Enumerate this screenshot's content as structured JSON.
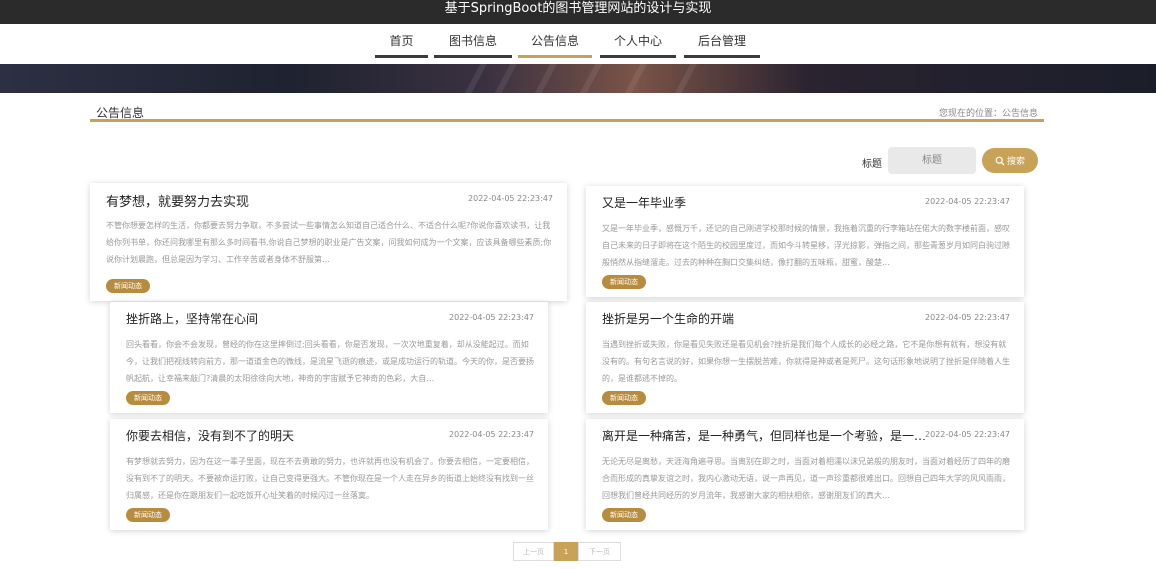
{
  "site_title": "基于SpringBoot的图书管理网站的设计与实现",
  "nav": [
    "首页",
    "图书信息",
    "公告信息",
    "个人中心",
    "后台管理"
  ],
  "section_title": "公告信息",
  "location": "您现在的位置：公告信息",
  "search": {
    "label": "标题",
    "placeholder": "标题",
    "button": "搜索"
  },
  "cards": [
    {
      "title": "有梦想，就要努力去实现",
      "date": "2022-04-05 22:23:47",
      "body": "不管你想要怎样的生活，你都要去努力争取，不多尝试一些事情怎么知道自己适合什么、不适合什么呢?你说你喜欢读书，让我给你列书单，你还问我哪里有那么多时间看书,你说自己梦想的职业是广告文案，问我如何成为一个文案，应该具备哪些素质;你说你计划晨跑，但总是因为学习、工作辛苦或者身体不舒服第…",
      "tag": "新闻动态"
    },
    {
      "title": "又是一年毕业季",
      "date": "2022-04-05 22:23:47",
      "body": "又是一年毕业季，感慨万千，还记的自己刚进学校那时候的情景，我拖着沉重的行李箱站在偌大的数字楼前面，感叹自己未来的日子即将在这个陌生的校园里度过，而如今斗转星移，浮光掠影，弹指之间，那些青葱岁月如同白驹过隙般悄然从指缝溜走。过去的种种在胸口交集纠结，像打翻的五味瓶，甜蜜，酸楚…",
      "tag": "新闻动态"
    },
    {
      "title": "挫折路上，坚持常在心间",
      "date": "2022-04-05 22:23:47",
      "body": "回头看看，你会不会发现，曾经的你在这里摔倒过;回头看看，你是否发现，一次次地重复着，却从没能起过。而如今，让我们把视线转向前方，那一道道金色的微线，是流星飞逝的痕迹，或是成功运行的轨道。今天的你，是否要扬帆起航，让幸福来敲门?清晨的太阳徐徐向大地，神奇的宇宙赋予它神奇的色彩，大自…",
      "tag": "新闻动态"
    },
    {
      "title": "挫折是另一个生命的开端",
      "date": "2022-04-05 22:23:47",
      "body": "当遇到挫折或失败，你是看见失败还是看见机会?挫折是我们每个人成长的必经之路，它不是你想有就有，想没有就没有的。有句名言说的好，如果你想一生摆脱苦难，你就得是神或者是死尸。这句话形象地说明了挫折是伴随着人生的，是谁都逃不掉的。",
      "tag": "新闻动态"
    },
    {
      "title": "你要去相信，没有到不了的明天",
      "date": "2022-04-05 22:23:47",
      "body": "有梦想就去努力，因为在这一辈子里面，现在不去勇敢的努力，也许就再也没有机会了。你要去相信，一定要相信，没有到不了的明天。不要被命运打败，让自己变得更强大。不管你现在是一个人走在异乡的街道上始终没有找到一丝归属感，还是你在跟朋友们一起吃饭开心址笑着的时候闪过一丝落寞。",
      "tag": "新闻动态"
    },
    {
      "title": "离开是一种痛苦，是一种勇气，但同样也是一个考验，是一个新的…",
      "date": "2022-04-05 22:23:47",
      "body": "无论无尽是离愁，天涯海角遍寻思。当离别在即之时，当面对着相濡以沫兄弟般的朋友时，当面对着经历了四年的磨合而形成的真挚友谊之时，我内心激动无语，说一声再见，道一声珍重都很难出口。回想自己四年大学的风风雨雨，回想我们曾经共同经历的岁月流年，我感谢大家的相扶相依，感谢朋友们的真大…",
      "tag": "新闻动态"
    }
  ],
  "pager": {
    "prev": "上一页",
    "current": "1",
    "next": "下一页"
  },
  "colors": {
    "accent": "#c7a257",
    "topbar": "#2b2b2b",
    "tag": "#b88c3e"
  }
}
